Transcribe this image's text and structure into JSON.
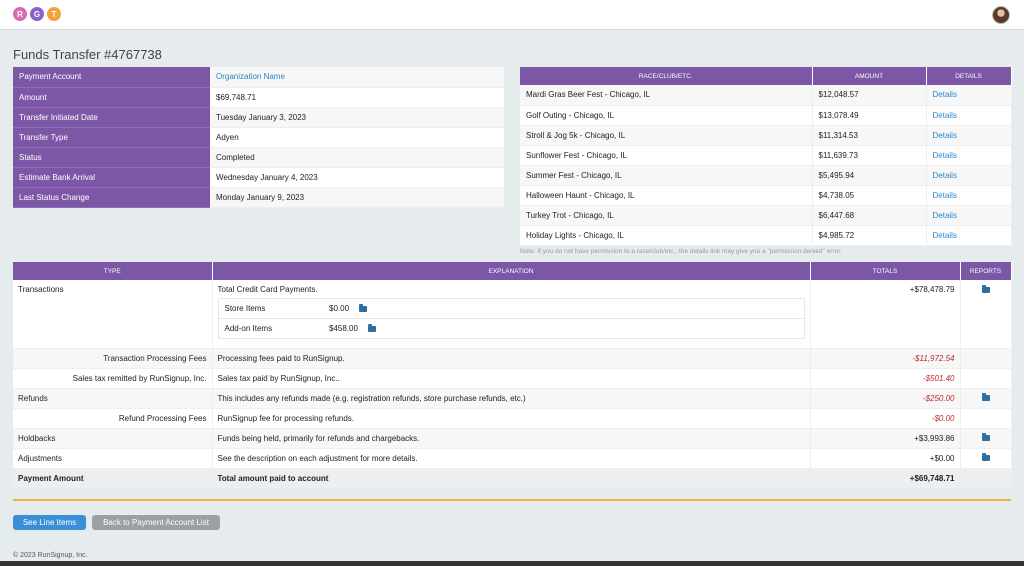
{
  "brand": {
    "letters": [
      "R",
      "G",
      "T"
    ],
    "colors": [
      "#d86bb1",
      "#8b62c9",
      "#f2a33a"
    ]
  },
  "page_title": "Funds Transfer #4767738",
  "account_info": [
    {
      "label": "Payment Account",
      "value": "Organization Name",
      "link": true
    },
    {
      "label": "Amount",
      "value": "$69,748.71"
    },
    {
      "label": "Transfer Initiated Date",
      "value": "Tuesday January 3, 2023"
    },
    {
      "label": "Transfer Type",
      "value": "Adyen"
    },
    {
      "label": "Status",
      "value": "Completed"
    },
    {
      "label": "Estimate Bank Arrival",
      "value": "Wednesday January 4, 2023"
    },
    {
      "label": "Last Status Change",
      "value": "Monday January 9, 2023"
    }
  ],
  "events": {
    "headers": [
      "RACE/CLUB/ETC.",
      "AMOUNT",
      "DETAILS"
    ],
    "rows": [
      {
        "name": "Mardi Gras Beer Fest - Chicago, IL",
        "amount": "$12,048.57",
        "details": "Details"
      },
      {
        "name": "Golf Outing - Chicago, IL",
        "amount": "$13,078.49",
        "details": "Details"
      },
      {
        "name": "Stroll & Jog 5k - Chicago, IL",
        "amount": "$11,314.53",
        "details": "Details"
      },
      {
        "name": "Sunflower Fest - Chicago, IL",
        "amount": "$11,639.73",
        "details": "Details"
      },
      {
        "name": "Summer Fest - Chicago, IL",
        "amount": "$5,495.94",
        "details": "Details"
      },
      {
        "name": "Halloween Haunt - Chicago, IL",
        "amount": "$4,738.05",
        "details": "Details"
      },
      {
        "name": "Turkey Trot - Chicago, IL",
        "amount": "$6,447.68",
        "details": "Details"
      },
      {
        "name": "Holiday Lights - Chicago, IL",
        "amount": "$4,985.72",
        "details": "Details"
      }
    ],
    "note": "Note: If you do not have permission to a race/club/etc., the details link may give you a \"permission denied\" error."
  },
  "breakdown": {
    "headers": [
      "TYPE",
      "EXPLANATION",
      "TOTALS",
      "REPORTS"
    ],
    "transactions": {
      "type": "Transactions",
      "explanation": "Total Credit Card Payments.",
      "total": "+$78,478.79",
      "sub": [
        {
          "label": "Store Items",
          "value": "$0.00"
        },
        {
          "label": "Add-on Items",
          "value": "$458.00"
        }
      ]
    },
    "rows": [
      {
        "type": "Transaction Processing Fees",
        "explanation": "Processing fees paid to RunSignup.",
        "total": "-$11,972.54"
      },
      {
        "type": "Sales tax remitted by RunSignup, Inc.",
        "explanation": "Sales tax paid by RunSignup, Inc..",
        "total": "-$501.40"
      },
      {
        "type": "Refunds",
        "explanation": "This includes any refunds made (e.g. registration refunds, store purchase refunds, etc.)",
        "total": "-$250.00"
      },
      {
        "type": "Refund Processing Fees",
        "explanation": "RunSignup fee for processing refunds.",
        "total": "-$0.00"
      },
      {
        "type": "Holdbacks",
        "explanation": "Funds being held, primarily for refunds and chargebacks.",
        "total": "+$3,993.86"
      },
      {
        "type": "Adjustments",
        "explanation": "See the description on each adjustment for more details.",
        "total": "+$0.00"
      },
      {
        "type": "Payment Amount",
        "explanation": "Total amount paid to account",
        "total": "+$69,748.71"
      }
    ]
  },
  "buttons": {
    "line_items": "See Line Items",
    "back": "Back to Payment Account List"
  },
  "footer": "© 2023 RunSignup, Inc."
}
